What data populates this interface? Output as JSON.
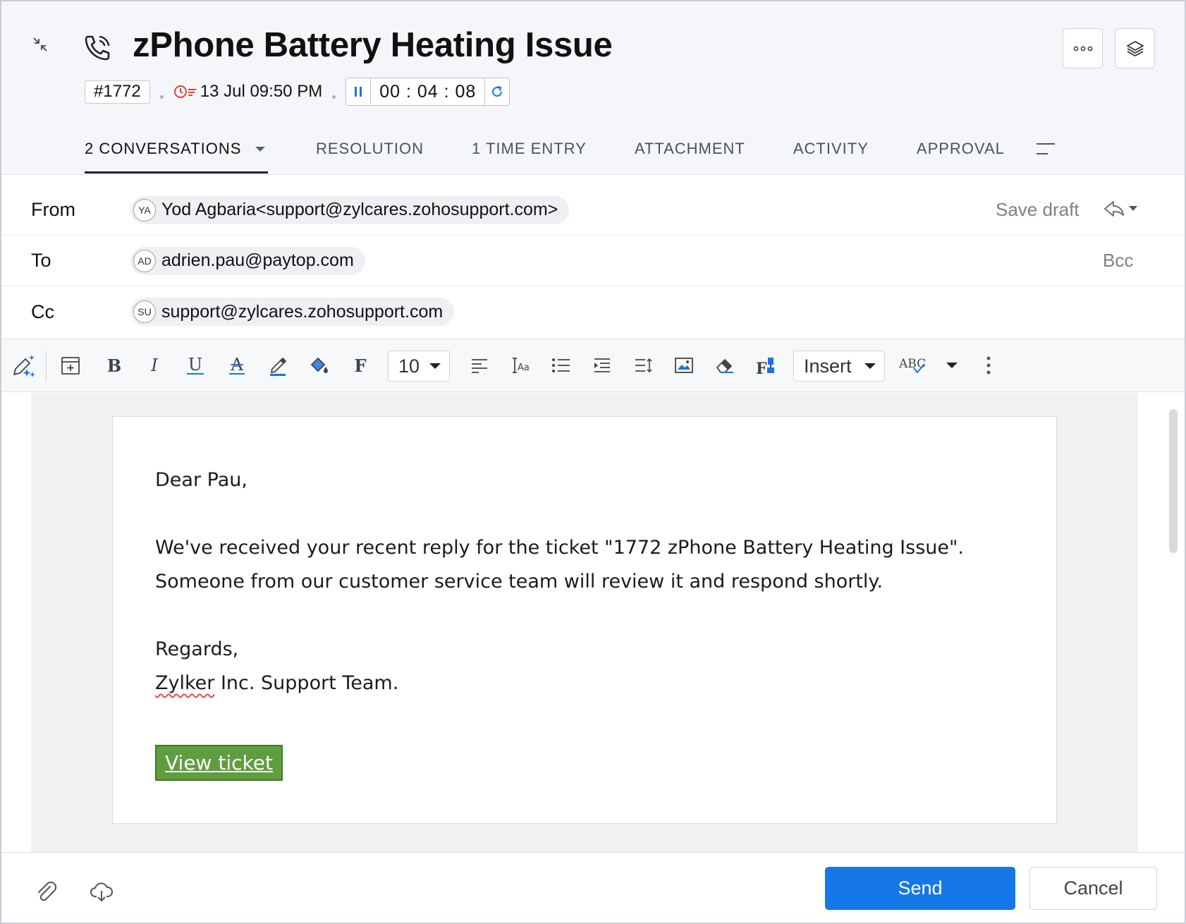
{
  "ticket": {
    "title": "zPhone Battery Heating Issue",
    "id": "#1772",
    "due": "13 Jul 09:50 PM",
    "timer": "00 : 04 : 08"
  },
  "tabs": [
    {
      "label": "2 CONVERSATIONS",
      "active": true
    },
    {
      "label": "RESOLUTION"
    },
    {
      "label": "1 TIME ENTRY"
    },
    {
      "label": "ATTACHMENT"
    },
    {
      "label": "ACTIVITY"
    },
    {
      "label": "APPROVAL"
    }
  ],
  "compose": {
    "from_label": "From",
    "to_label": "To",
    "cc_label": "Cc",
    "from": {
      "initials": "YA",
      "value": "Yod Agbaria<support@zylcares.zohosupport.com>"
    },
    "to": {
      "initials": "AD",
      "value": "adrien.pau@paytop.com"
    },
    "cc": {
      "initials": "SU",
      "value": "support@zylcares.zohosupport.com"
    },
    "save_draft": "Save draft",
    "bcc": "Bcc"
  },
  "toolbar": {
    "font_size": "10",
    "insert_label": "Insert",
    "spellcheck_label": "ABC"
  },
  "message": {
    "greeting": "Dear Pau,",
    "line1": "We've received your recent reply for the ticket \"1772 zPhone Battery Heating Issue\".",
    "line2": "Someone from our customer service team will review it and respond shortly.",
    "regards": "Regards,",
    "signature_word": "Zylker",
    "signature_rest": " Inc. Support Team.",
    "button": "View ticket"
  },
  "footer": {
    "send": "Send",
    "cancel": "Cancel"
  },
  "colors": {
    "accent": "#1577e6",
    "timer_blue": "#1a73e8",
    "due_red": "#e0443a",
    "view_ticket_green": "#5f9d3f"
  },
  "icons": [
    "collapse-icon",
    "phone-call-icon",
    "more-icon",
    "layers-icon",
    "due-clock-icon",
    "pause-icon",
    "refresh-icon",
    "tab-menu-icon",
    "reply-icon",
    "ai-pen-icon",
    "template-icon",
    "bold-icon",
    "italic-icon",
    "underline-icon",
    "strikethrough-icon",
    "text-color-icon",
    "fill-color-icon",
    "font-icon",
    "align-icon",
    "font-size-icon",
    "list-icon",
    "indent-icon",
    "line-height-icon",
    "image-icon",
    "eraser-icon",
    "format-painter-icon",
    "more-vertical-icon",
    "attach-icon",
    "cloud-download-icon"
  ]
}
